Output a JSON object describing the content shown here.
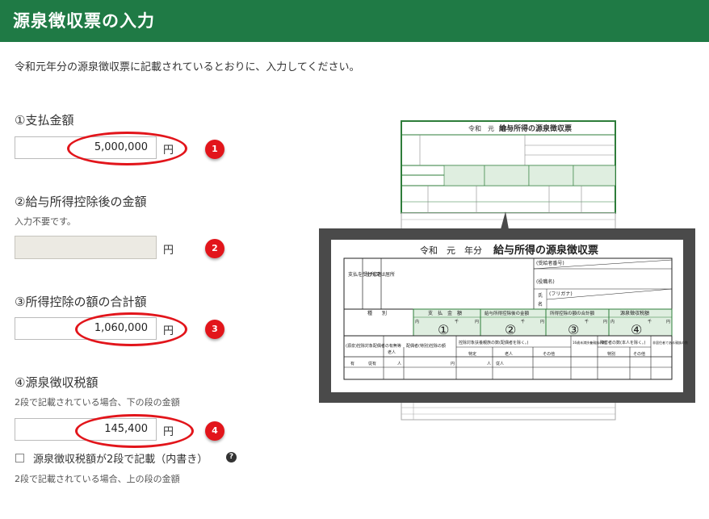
{
  "header": {
    "title": "源泉徴収票の入力"
  },
  "intro": "令和元年分の源泉徴収票に記載されているとおりに、入力してください。",
  "fields": [
    {
      "label": "①支払金額",
      "value": "5,000,000",
      "unit": "円",
      "badge": "1"
    },
    {
      "label": "②給与所得控除後の金額",
      "note": "入力不要です。",
      "value": "",
      "unit": "円",
      "badge": "2"
    },
    {
      "label": "③所得控除の額の合計額",
      "value": "1,060,000",
      "unit": "円",
      "badge": "3"
    },
    {
      "label": "④源泉徴収税額",
      "note": "2段で記載されている場合、下の段の金額",
      "value": "145,400",
      "unit": "円",
      "badge": "4"
    }
  ],
  "checkbox": {
    "label": "源泉徴収税額が2段で記載（内書き）",
    "checked": false,
    "help": "?"
  },
  "note_bottom": "2段で記載されている場合、上の段の金額",
  "illustration": {
    "year": "令和　元　年分",
    "title": "給与所得の源泉徴収票",
    "payer_label": "支払を受ける者",
    "address_label": "住所又は居所",
    "id_label": "(受給者番号)",
    "position_label": "(役職名)",
    "kana_label": "(フリガナ)",
    "name_label_1": "氏",
    "name_label_2": "名",
    "col_type": "種　　別",
    "col1": "支　払　金　額",
    "col2": "給与所得控除後の金額",
    "col3": "所得控除の額の合計額",
    "col4": "源泉徴収税額",
    "unit_inner": "内",
    "unit_sen": "千",
    "unit_yen": "円",
    "m1": "①",
    "m2": "②",
    "m3": "③",
    "m4": "④",
    "row2_a": "(源泉)控除対象配偶者の有無等",
    "row2_b": "老人",
    "row2_c": "配偶者(特別)控除の額",
    "row2_d": "控除対象扶養親族の数(配偶者を除く。)",
    "row2_e": "特定",
    "row2_f": "老人",
    "row2_g": "その他",
    "row2_h": "16歳未満扶養親族の数",
    "row2_i": "障害者の数(本人を除く。)",
    "row2_j": "特別",
    "row2_k": "その他",
    "row2_l": "非居住者である親族の数",
    "row3_a": "有",
    "row3_b": "従有",
    "row3_c": "人",
    "row3_d": "従人"
  },
  "colors": {
    "header": "#1f7a45",
    "accent": "#e2151b",
    "green_cells": "#dfeee0",
    "frame": "#4a4a4a"
  }
}
